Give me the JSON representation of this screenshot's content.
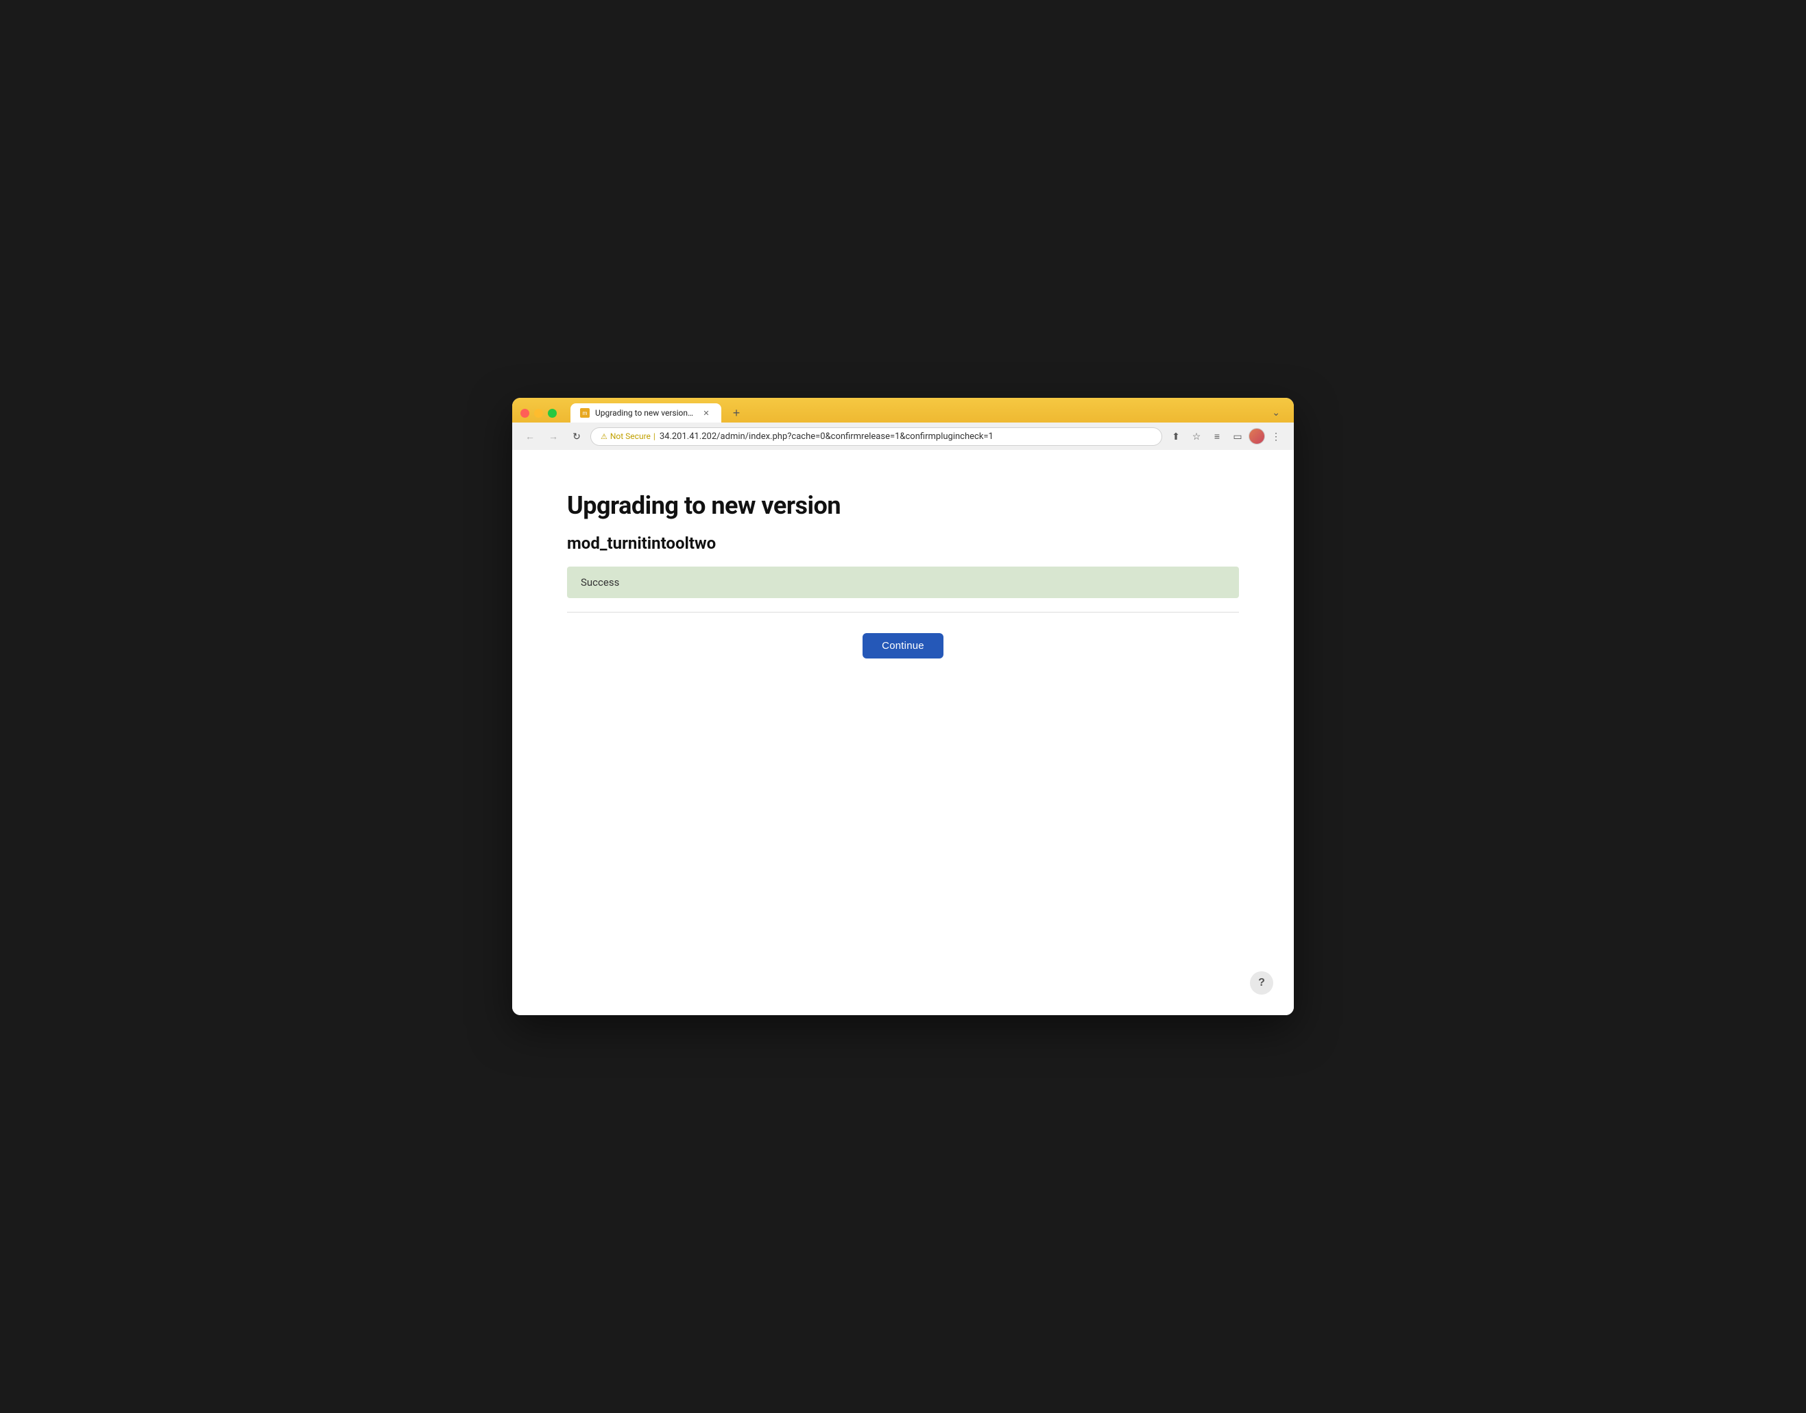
{
  "browser": {
    "tab_title": "Upgrading to new version - Mo",
    "tab_favicon_text": "m",
    "new_tab_label": "+",
    "chevron_label": "⌄",
    "nav_back": "←",
    "nav_forward": "→",
    "nav_refresh": "↻",
    "security_label": "Not Secure",
    "url": "34.201.41.202/admin/index.php?cache=0&confirmrelease=1&confirmplugincheck=1",
    "share_icon": "⬆",
    "bookmark_icon": "☆",
    "extensions_icon": "≡",
    "sidebar_icon": "▭",
    "menu_icon": "⋮"
  },
  "page": {
    "main_title": "Upgrading to new version",
    "plugin_name": "mod_turnitintooltwo",
    "success_message": "Success",
    "continue_label": "Continue",
    "help_label": "?"
  }
}
